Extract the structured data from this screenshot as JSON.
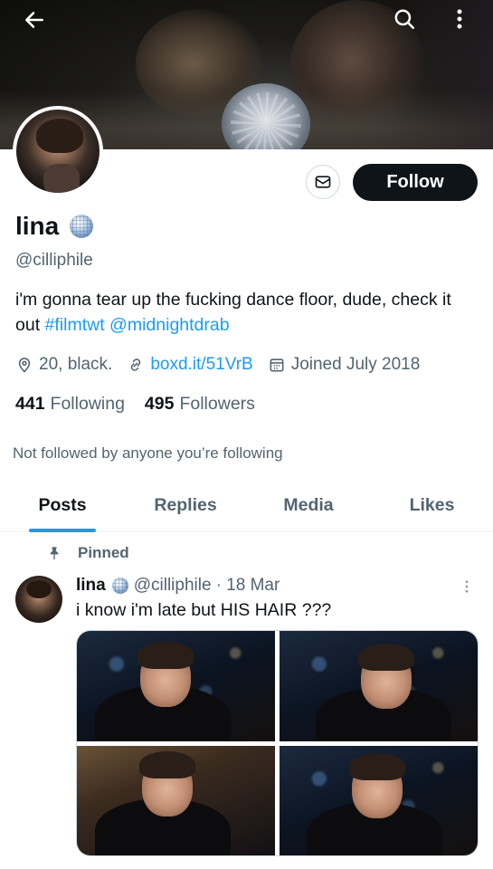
{
  "profile": {
    "name": "lina",
    "handle": "@cilliphile",
    "bio_text": "i'm gonna tear up the fucking dance floor, dude, check it out ",
    "bio_hashtag": "#filmtwt",
    "bio_mention": "@midnightdrab",
    "location": "20, black.",
    "website": "boxd.it/51VrB",
    "joined": "Joined July 2018",
    "following_count": "441",
    "following_label": "Following",
    "followers_count": "495",
    "followers_label": "Followers",
    "not_followed_text": "Not followed by anyone you’re following"
  },
  "actions": {
    "follow_label": "Follow"
  },
  "tabs": [
    {
      "label": "Posts",
      "active": true
    },
    {
      "label": "Replies",
      "active": false
    },
    {
      "label": "Media",
      "active": false
    },
    {
      "label": "Likes",
      "active": false
    }
  ],
  "post": {
    "pinned_label": "Pinned",
    "author_name": "lina",
    "author_handle": "@cilliphile",
    "date": "· 18 Mar",
    "text": "i know i'm late but HIS HAIR ???",
    "photo_count": 4
  },
  "colors": {
    "accent": "#1d9bf0",
    "text_primary": "#0f1419",
    "text_secondary": "#536471",
    "button_dark": "#0f1419"
  },
  "icons": [
    "back-arrow-icon",
    "search-icon",
    "more-vertical-icon",
    "mail-icon",
    "disco-ball-emoji-icon",
    "location-pin-icon",
    "link-icon",
    "calendar-icon",
    "pin-icon"
  ]
}
